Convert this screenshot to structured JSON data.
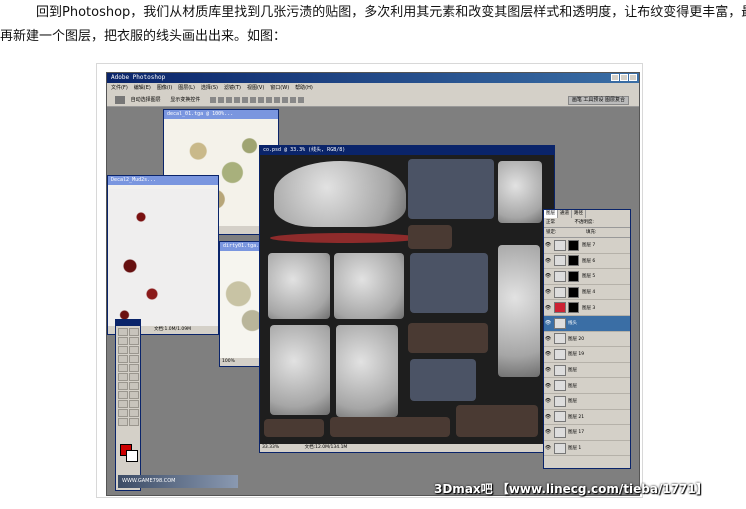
{
  "article": {
    "line1": "回到Photoshop，我们从材质库里找到几张污渍的贴图，多次利用其元素和改变其图层样式和透明度，让布纹变得更丰富，最后",
    "line2": "再新建一个图层，把衣服的线头画出出来。如图："
  },
  "photoshop": {
    "title": "Adobe Photoshop",
    "menu": [
      "文件(F)",
      "编辑(E)",
      "图像(I)",
      "图层(L)",
      "选择(S)",
      "滤镜(T)",
      "视图(V)",
      "窗口(W)",
      "帮助(H)"
    ],
    "options": {
      "auto_select": "自动选择图层",
      "show_transform": "显示变换控件",
      "workspace": "画笔  工具预设  图层复合"
    },
    "windows": {
      "decal1": {
        "title": "decal_01.tga @ 100%...",
        "zoom": "100%"
      },
      "decal2": {
        "title": "Decal2_Mud2s...",
        "status": "文档:1.0M/1.09M"
      },
      "dirt": {
        "title": "dirty01.tga...",
        "zoom": "100%"
      },
      "main": {
        "title": "co.psd @ 33.3% (线头, RGB/8)",
        "zoom": "33.33%",
        "status": "文档:12.0M/134.1M"
      }
    },
    "layers_panel": {
      "tabs": [
        "图层",
        "通道",
        "路径"
      ],
      "blend_mode": "正常",
      "opacity_label": "不透明度:",
      "lock_label": "锁定:",
      "fill_label": "填充:",
      "layers": [
        {
          "name": "图层 7",
          "masked": true,
          "selected": false
        },
        {
          "name": "图层 6",
          "masked": true,
          "selected": false
        },
        {
          "name": "图层 5",
          "masked": true,
          "selected": false
        },
        {
          "name": "图层 4",
          "masked": true,
          "selected": false
        },
        {
          "name": "图层 3",
          "masked": true,
          "selected": false
        },
        {
          "name": "线头",
          "masked": false,
          "selected": true
        },
        {
          "name": "图层 20",
          "masked": false,
          "selected": false
        },
        {
          "name": "图层 19",
          "masked": false,
          "selected": false
        },
        {
          "name": "图层",
          "masked": false,
          "selected": false
        },
        {
          "name": "图层",
          "masked": false,
          "selected": false
        },
        {
          "name": "图层",
          "masked": false,
          "selected": false
        },
        {
          "name": "图层 21",
          "masked": false,
          "selected": false
        },
        {
          "name": "图层 17",
          "masked": false,
          "selected": false
        },
        {
          "name": "图层 1",
          "masked": false,
          "selected": false
        }
      ]
    },
    "toolbox_logo": "GAME798",
    "game_logo": "WWW.GAME798.COM"
  },
  "watermark": "3Dmax吧 【www.linecg.com/tieba/1771】"
}
